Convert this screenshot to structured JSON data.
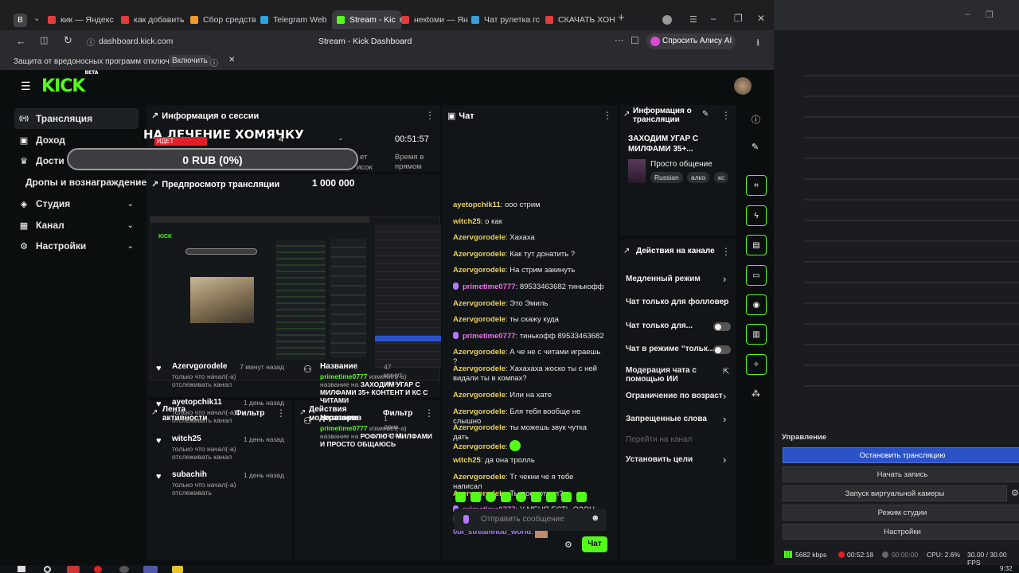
{
  "browser": {
    "tabs": [
      {
        "label": "кик — Яндекс",
        "color": "#e23c3c"
      },
      {
        "label": "как добавить",
        "color": "#e23c3c"
      },
      {
        "label": "Сбор средств",
        "color": "#f29a2e"
      },
      {
        "label": "Telegram Web",
        "color": "#2aa3e0"
      },
      {
        "label": "Stream - Kic",
        "color": "#53fc18"
      },
      {
        "label": "некtоми — Ян",
        "color": "#e23c3c"
      },
      {
        "label": "Чат рулетка гс",
        "color": "#3b9ed6"
      },
      {
        "label": "СКАЧАТЬ ХОН",
        "color": "#e23c3c"
      }
    ],
    "url": "dashboard.kick.com",
    "page_title": "Stream - Kick Dashboard",
    "alice_label": "Спросить Алису AI",
    "warning_text": "Защита от вредоносных программ отключена",
    "warning_button": "Включить"
  },
  "sidebar": {
    "items": [
      {
        "label": "Трансляция",
        "icon": "broadcast-icon"
      },
      {
        "label": "Доход",
        "icon": "income-icon"
      },
      {
        "label": "Дости",
        "icon": "trophy-icon"
      },
      {
        "label": "Дропы и вознаграждение",
        "icon": ""
      },
      {
        "label": "Студия",
        "icon": "studio-icon"
      },
      {
        "label": "Канал",
        "icon": "channel-icon"
      },
      {
        "label": "Настройки",
        "icon": "settings-icon"
      }
    ]
  },
  "overlay": {
    "title": "НА ЛЕЧЕНИЕ ХОМЯЧКУ",
    "goal_label": "0 RUB (0%)",
    "goal_amount": "1 000 000",
    "badge": "ИДЕТ"
  },
  "session": {
    "title": "Информация о сессии",
    "values": [
      "4",
      "-",
      "00:51:57"
    ],
    "labels": [
      "ет",
      "исок",
      "Время в прямом"
    ]
  },
  "preview": {
    "title": "Предпросмотр трансляции"
  },
  "chat": {
    "title": "Чат",
    "messages": [
      {
        "user": "ayetopchik11",
        "text": "ооо стрим",
        "cls": "u-yellow",
        "mic": false
      },
      {
        "user": "witch25",
        "text": "о как",
        "cls": "u-yellow",
        "mic": false
      },
      {
        "user": "Azervgorodele",
        "text": "Хахаха",
        "cls": "u-yellow",
        "mic": false
      },
      {
        "user": "Azervgorodele",
        "text": "Как тут донатить ?",
        "cls": "u-yellow",
        "mic": false
      },
      {
        "user": "Azervgorodele",
        "text": "На стрим закинуть",
        "cls": "u-yellow",
        "mic": false
      },
      {
        "user": "primetime0777",
        "text": "89533463682 тинькофф",
        "cls": "u-pink",
        "mic": true
      },
      {
        "user": "Azervgorodele",
        "text": "Это Эмиль",
        "cls": "u-yellow",
        "mic": false
      },
      {
        "user": "Azervgorodele",
        "text": "ты скажу куда",
        "cls": "u-yellow",
        "mic": false
      },
      {
        "user": "primetime0777",
        "text": "тинькофф 89533463682",
        "cls": "u-pink",
        "mic": true
      },
      {
        "user": "Azervgorodele",
        "text": "А че не с читами играешь ?",
        "cls": "u-yellow",
        "mic": false
      },
      {
        "user": "Azervgorodele",
        "text": "Хахахаха жоско ты с ней видали ты в компах?",
        "cls": "u-yellow",
        "mic": false
      },
      {
        "user": "Azervgorodele",
        "text": "Или на хате",
        "cls": "u-yellow",
        "mic": false
      },
      {
        "user": "Azervgorodele",
        "text": "Бля тебя вообще не слышно",
        "cls": "u-yellow",
        "mic": false
      },
      {
        "user": "Azervgorodele",
        "text": "ты можешь звук чутка дать",
        "cls": "u-yellow",
        "mic": false
      },
      {
        "user": "Azervgorodele",
        "text": "",
        "cls": "u-yellow",
        "mic": false
      },
      {
        "user": "witch25",
        "text": "да она тролль",
        "cls": "u-yellow",
        "mic": false
      },
      {
        "user": "Azervgorodele",
        "text": "Тг чекни че я тебе написал",
        "cls": "u-yellow",
        "mic": false
      },
      {
        "user": "Azervgorodele",
        "text": "Ты посмотрел?",
        "cls": "u-yellow",
        "mic": false
      },
      {
        "user": "primetime0777",
        "text": "У МЕНЯ ЕСТЬ ОЗОН НА ЭТОТ НОМЕР",
        "cls": "u-pink",
        "mic": true
      },
      {
        "user": "0bl_streamhub_world",
        "text": "",
        "cls": "u-purple",
        "mic": false
      }
    ],
    "input_placeholder": "Отправить сообщение",
    "send_label": "Чат"
  },
  "stream_info": {
    "title": "Информация о трансляции",
    "stream_title": "ЗАХОДИМ УГАР С МИЛФАМИ 35+...",
    "category": "Просто общение",
    "tags": [
      "Russian",
      "алко",
      "кс"
    ]
  },
  "actions": {
    "title": "Действия на канале",
    "rows": [
      {
        "label": "Медленный режим",
        "kind": "chevron"
      },
      {
        "label": "Чат только для фолловер",
        "kind": "chevron"
      },
      {
        "label": "Чат только для...",
        "kind": "toggle"
      },
      {
        "label": "Чат в режиме “тольк...",
        "kind": "toggle"
      },
      {
        "label": "Модерация чата с помощью ИИ",
        "kind": "external"
      },
      {
        "label": "Ограничение по возраст",
        "kind": "chevron"
      },
      {
        "label": "Запрещенные слова",
        "kind": "chevron"
      },
      {
        "label": "Перейти на канал",
        "kind": "disabled"
      },
      {
        "label": "Установить цели",
        "kind": "chevron"
      }
    ]
  },
  "activity": {
    "title": "Лента активности",
    "filter": "Фильтр",
    "items": [
      {
        "name": "Azervgorodele",
        "time": "7 минут назад",
        "desc": "только что начал(-а) отслеживать канал"
      },
      {
        "name": "ayetopchik11",
        "time": "1 день назад",
        "desc": "только что начал(-а) отслеживать канал"
      },
      {
        "name": "witch25",
        "time": "1 день назад",
        "desc": "только что начал(-а) отслеживать канал"
      },
      {
        "name": "subachih",
        "time": "1 день назад",
        "desc": "только что начал(-а) отслеживать"
      }
    ]
  },
  "mod_actions": {
    "title": "Действия модераторов",
    "filter": "Фильтр",
    "items": [
      {
        "label": "Название",
        "time": "47 минут назад",
        "user": "primetime0777",
        "verb": "изменил(-а) название на",
        "value": "ЗАХОДИМ УГАР С МИЛФАМИ 35+ КОНТЕНТ И КС С ЧИТАМИ"
      },
      {
        "label": "Название",
        "time": "1 день назад",
        "user": "primetime0777",
        "verb": "изменил(-а) название на",
        "value": "РОФЛЮ С МИЛФАМИ И ПРОСТО ОБЩАЮСЬ"
      }
    ]
  },
  "obs": {
    "section_title": "Управление",
    "buttons": [
      "Остановить трансляцию",
      "Начать запись",
      "Запуск виртуальной камеры",
      "Режим студии",
      "Настройки"
    ],
    "stats": [
      "5682 kbps",
      "00:52:18",
      "00:00:00",
      "CPU: 2.6%",
      "30.00 / 30.00 FPS"
    ],
    "accent": "#2b53c7"
  },
  "taskbar": {
    "clock": "9:32"
  },
  "colors": {
    "kick_green": "#53fc18",
    "bg": "#0b0e0f",
    "panel": "#121517"
  }
}
